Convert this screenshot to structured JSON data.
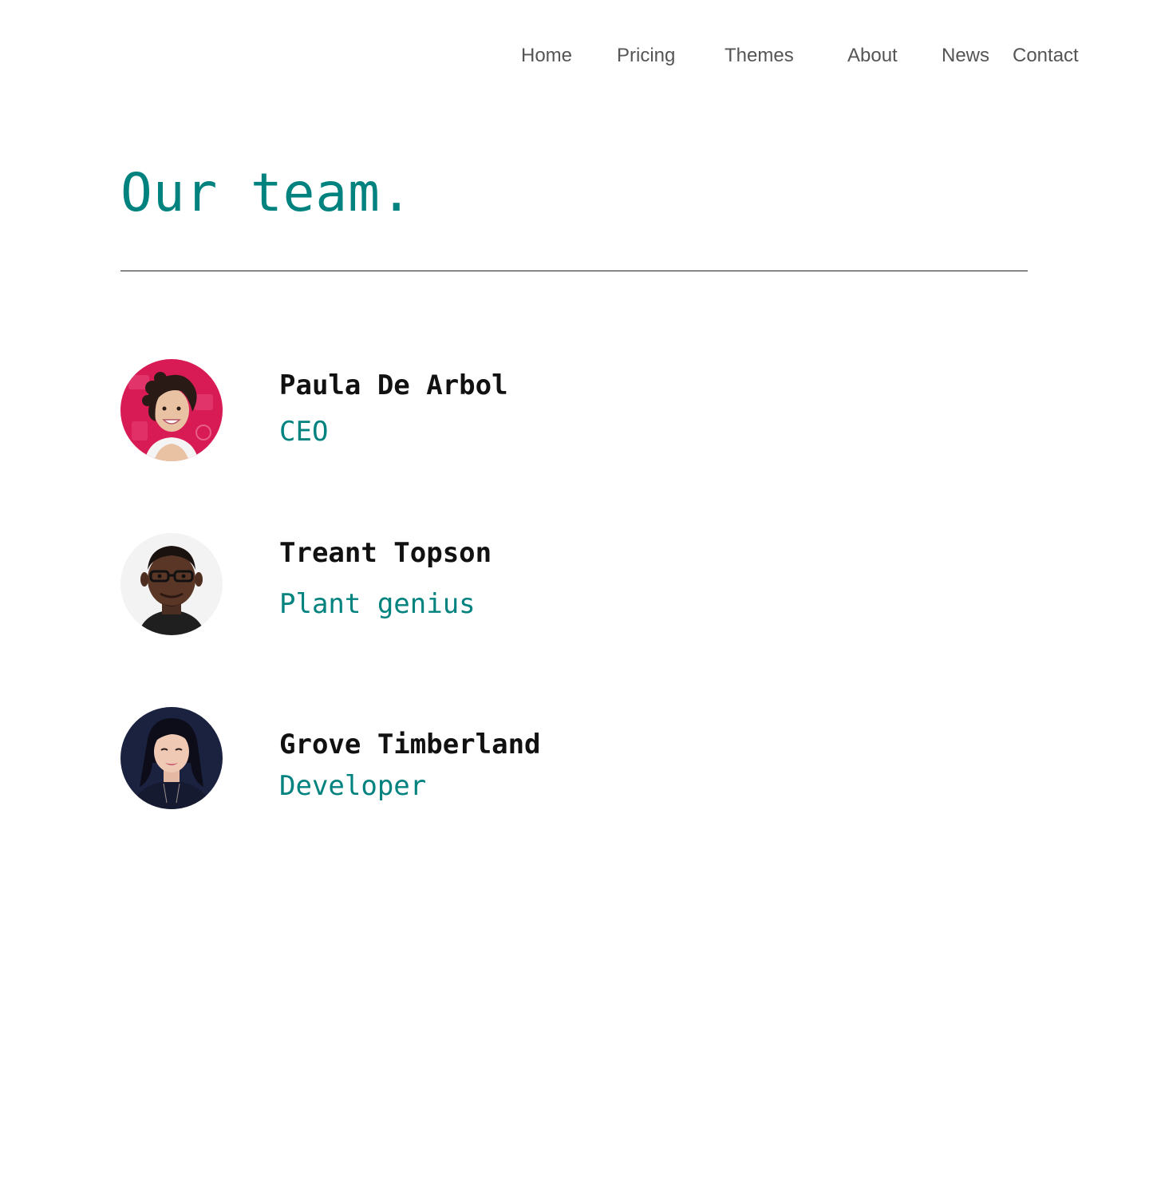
{
  "nav": {
    "items": [
      {
        "label": "Home"
      },
      {
        "label": "Pricing"
      },
      {
        "label": "Themes"
      },
      {
        "label": "About"
      },
      {
        "label": "News"
      },
      {
        "label": "Contact"
      }
    ]
  },
  "page": {
    "title": "Our team."
  },
  "team": {
    "members": [
      {
        "name": "Paula De Arbol",
        "role": "CEO",
        "avatar_icon": "avatar-photo-icon"
      },
      {
        "name": "Treant Topson",
        "role": "Plant genius",
        "avatar_icon": "avatar-photo-icon"
      },
      {
        "name": "Grove Timberland",
        "role": "Developer",
        "avatar_icon": "avatar-photo-icon"
      }
    ]
  },
  "colors": {
    "accent": "#00827f",
    "nav_text": "#555555",
    "name_text": "#111111",
    "divider": "#222222",
    "background": "#ffffff"
  }
}
